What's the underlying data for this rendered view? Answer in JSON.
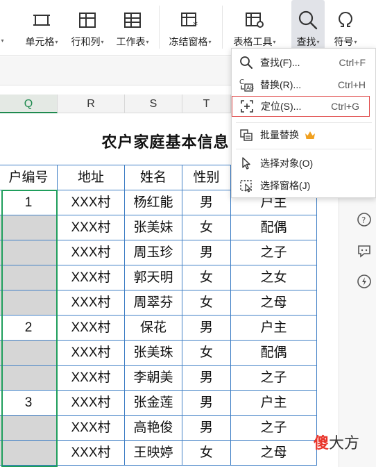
{
  "ribbon": {
    "buttons": [
      {
        "label": "单元格"
      },
      {
        "label": "行和列"
      },
      {
        "label": "工作表"
      },
      {
        "label": "冻结窗格"
      },
      {
        "label": "表格工具"
      },
      {
        "label": "查找"
      },
      {
        "label": "符号"
      }
    ]
  },
  "columns": [
    "Q",
    "R",
    "S",
    "T"
  ],
  "sheet": {
    "title": "农户家庭基本信息",
    "headers": [
      "户编号",
      "地址",
      "姓名",
      "性别"
    ],
    "rows": [
      {
        "id": "1",
        "addr": "XXX村",
        "name": "杨红能",
        "sex": "男",
        "rel": "户主"
      },
      {
        "id": "",
        "addr": "XXX村",
        "name": "张美妹",
        "sex": "女",
        "rel": "配偶"
      },
      {
        "id": "",
        "addr": "XXX村",
        "name": "周玉珍",
        "sex": "男",
        "rel": "之子"
      },
      {
        "id": "",
        "addr": "XXX村",
        "name": "郭天明",
        "sex": "女",
        "rel": "之女"
      },
      {
        "id": "",
        "addr": "XXX村",
        "name": "周翠芬",
        "sex": "女",
        "rel": "之母"
      },
      {
        "id": "2",
        "addr": "XXX村",
        "name": "保花",
        "sex": "男",
        "rel": "户主"
      },
      {
        "id": "",
        "addr": "XXX村",
        "name": "张美珠",
        "sex": "女",
        "rel": "配偶"
      },
      {
        "id": "",
        "addr": "XXX村",
        "name": "李朝美",
        "sex": "男",
        "rel": "之子"
      },
      {
        "id": "3",
        "addr": "XXX村",
        "name": "张金莲",
        "sex": "男",
        "rel": "户主"
      },
      {
        "id": "",
        "addr": "XXX村",
        "name": "高艳俊",
        "sex": "男",
        "rel": "之子"
      },
      {
        "id": "",
        "addr": "XXX村",
        "name": "王映婷",
        "sex": "女",
        "rel": "之母"
      }
    ]
  },
  "find_menu": {
    "items": [
      {
        "label": "查找(F)...",
        "shortcut": "Ctrl+F",
        "icon": "search-icon"
      },
      {
        "label": "替换(R)...",
        "shortcut": "Ctrl+H",
        "icon": "replace-icon"
      },
      {
        "label": "定位(S)...",
        "shortcut": "Ctrl+G",
        "icon": "locate-icon"
      },
      {
        "label": "批量替换",
        "icon": "batch-replace-icon"
      },
      {
        "label": "选择对象(O)",
        "icon": "cursor-icon"
      },
      {
        "label": "选择窗格(J)",
        "icon": "selection-pane-icon"
      }
    ]
  },
  "watermark": {
    "brand_red": "傻",
    "brand_rest": "大方"
  },
  "colors": {
    "accent_green": "#1f9e5c",
    "table_border": "#3f7fc5",
    "highlight_red": "#e04848",
    "crown": "#f0a020"
  }
}
